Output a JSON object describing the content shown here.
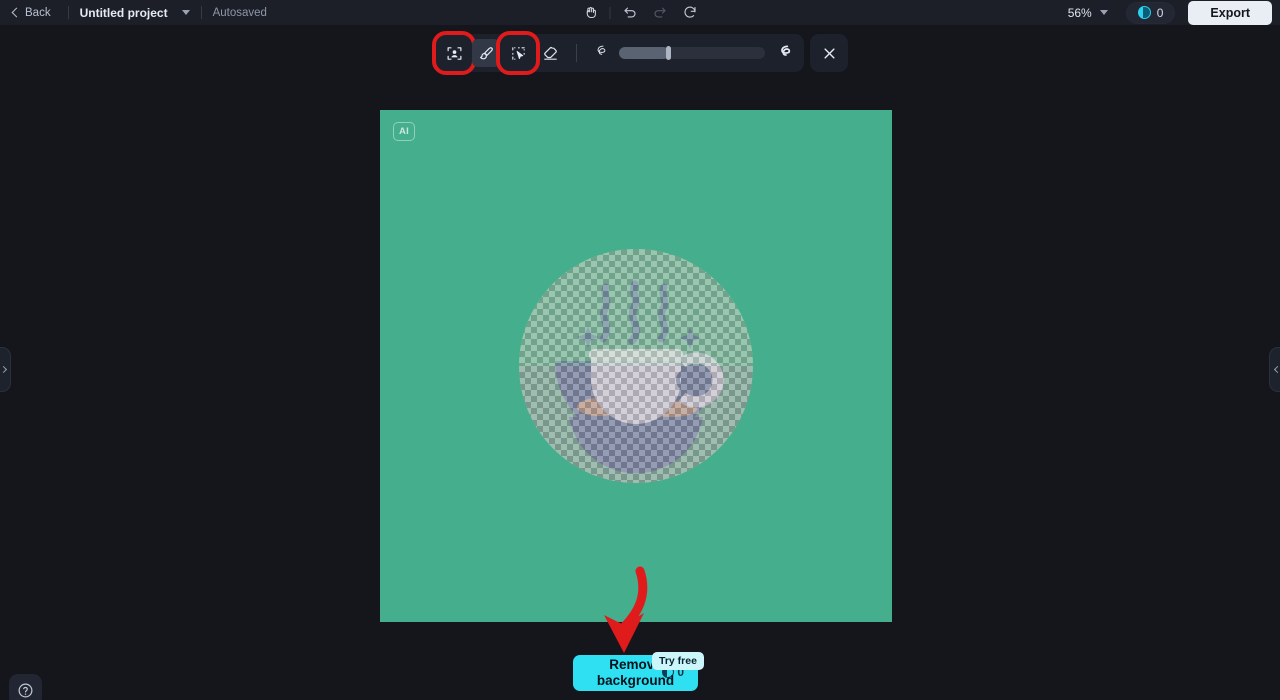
{
  "app": {
    "background_color": "#14161c",
    "accent_cyan": "#2ee0f2",
    "highlight_color": "#e01b1b"
  },
  "topbar": {
    "back_label": "Back",
    "project_title": "Untitled project",
    "project_caret_icon": "chevron-down-icon",
    "autosave_status": "Autosaved",
    "tools": [
      {
        "name": "hand-tool-icon",
        "label": "Hand"
      },
      {
        "name": "undo-icon",
        "label": "Undo"
      },
      {
        "name": "redo-icon",
        "label": "Redo"
      },
      {
        "name": "reset-icon",
        "label": "Reset"
      }
    ],
    "zoom_level": "56%",
    "zoom_caret_icon": "chevron-down-icon",
    "credits_icon": "credit-coin-icon",
    "credits_count": "0",
    "export_label": "Export"
  },
  "toolbar": {
    "buttons": [
      {
        "name": "select-subject-tool",
        "label": "Select subject",
        "icon": "person-in-frame-icon",
        "state": "highlighted"
      },
      {
        "name": "brush-tool",
        "label": "Brush",
        "icon": "paintbrush-icon",
        "state": "active"
      },
      {
        "name": "magic-select-tool",
        "label": "Magic select",
        "icon": "cursor-selection-icon",
        "state": "highlighted"
      },
      {
        "name": "eraser-tool",
        "label": "Eraser",
        "icon": "eraser-icon",
        "state": "default"
      }
    ],
    "brush_size": {
      "small_icon": "small-stroke-icon",
      "large_icon": "large-stroke-icon",
      "value_percent": 34
    },
    "close_label": "Close",
    "close_icon": "close-x-icon"
  },
  "canvas": {
    "ai_badge": "AI",
    "background_color": "#45ae8c",
    "artwork_alt": "Coffee cup with steam on a saucer",
    "selection_mask": "checkerboard-overlay",
    "zoom": "56%"
  },
  "annotations": {
    "arrow": "red-down-arrow",
    "arrow_color": "#e01b1b"
  },
  "cta": {
    "label": "Remove background",
    "badge": "Try free",
    "cost_icon": "credit-coin-icon",
    "cost": "0"
  },
  "panels": {
    "left_handle_icon": "chevron-right-icon",
    "right_handle_icon": "chevron-left-icon"
  },
  "help": {
    "label": "Help",
    "icon": "question-mark-icon"
  }
}
